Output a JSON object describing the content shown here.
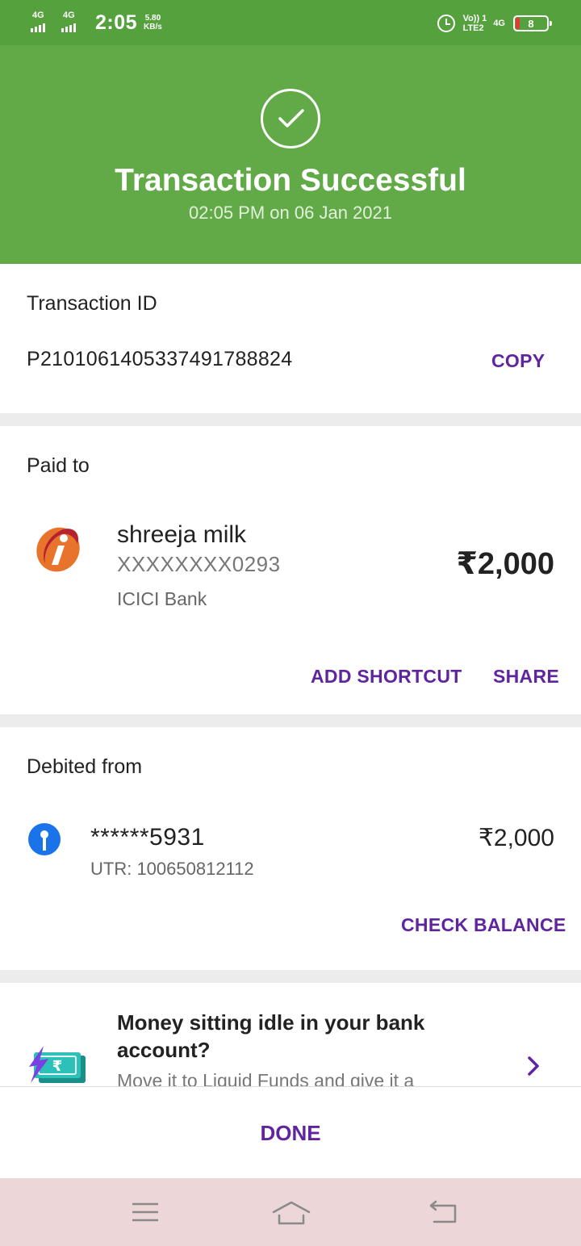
{
  "status_bar": {
    "network_left_1": "4G",
    "network_left_2": "4G",
    "time": "2:05",
    "speed_value": "5.80",
    "speed_unit": "KB/s",
    "volte_line1": "Vo)) 1",
    "volte_line2": "LTE2",
    "network_right": "4G",
    "battery_level": "8",
    "icons": [
      "signal-icon",
      "alarm-icon",
      "battery-icon"
    ]
  },
  "header": {
    "status_icon": "check-circle-icon",
    "title": "Transaction Successful",
    "datetime": "02:05 PM on 06 Jan 2021",
    "color": "#61aa47"
  },
  "transaction": {
    "label": "Transaction ID",
    "id": "P2101061405337491788824",
    "copy_label": "COPY"
  },
  "paid_to": {
    "label": "Paid to",
    "bank_icon": "icici-bank-logo-icon",
    "name": "shreeja milk",
    "account": "XXXXXXXX0293",
    "bank": "ICICI Bank",
    "amount": "₹2,000",
    "add_shortcut_label": "ADD SHORTCUT",
    "share_label": "SHARE"
  },
  "debited_from": {
    "label": "Debited from",
    "bank_icon": "sbi-bank-logo-icon",
    "account": "******5931",
    "utr": "UTR: 100650812112",
    "amount": "₹2,000",
    "check_balance_label": "CHECK BALANCE"
  },
  "promo": {
    "icon": "liquid-funds-money-icon",
    "title": "Money sitting idle in your bank account?",
    "subtitle": "Move it to Liquid Funds and give it a",
    "chevron_icon": "chevron-right-icon"
  },
  "footer": {
    "done_label": "DONE"
  },
  "nav": {
    "icons": [
      "menu-icon",
      "home-icon",
      "back-icon"
    ]
  },
  "colors": {
    "accent": "#5f259f",
    "success_green": "#61aa47",
    "statusbar_green": "#55a13e"
  }
}
